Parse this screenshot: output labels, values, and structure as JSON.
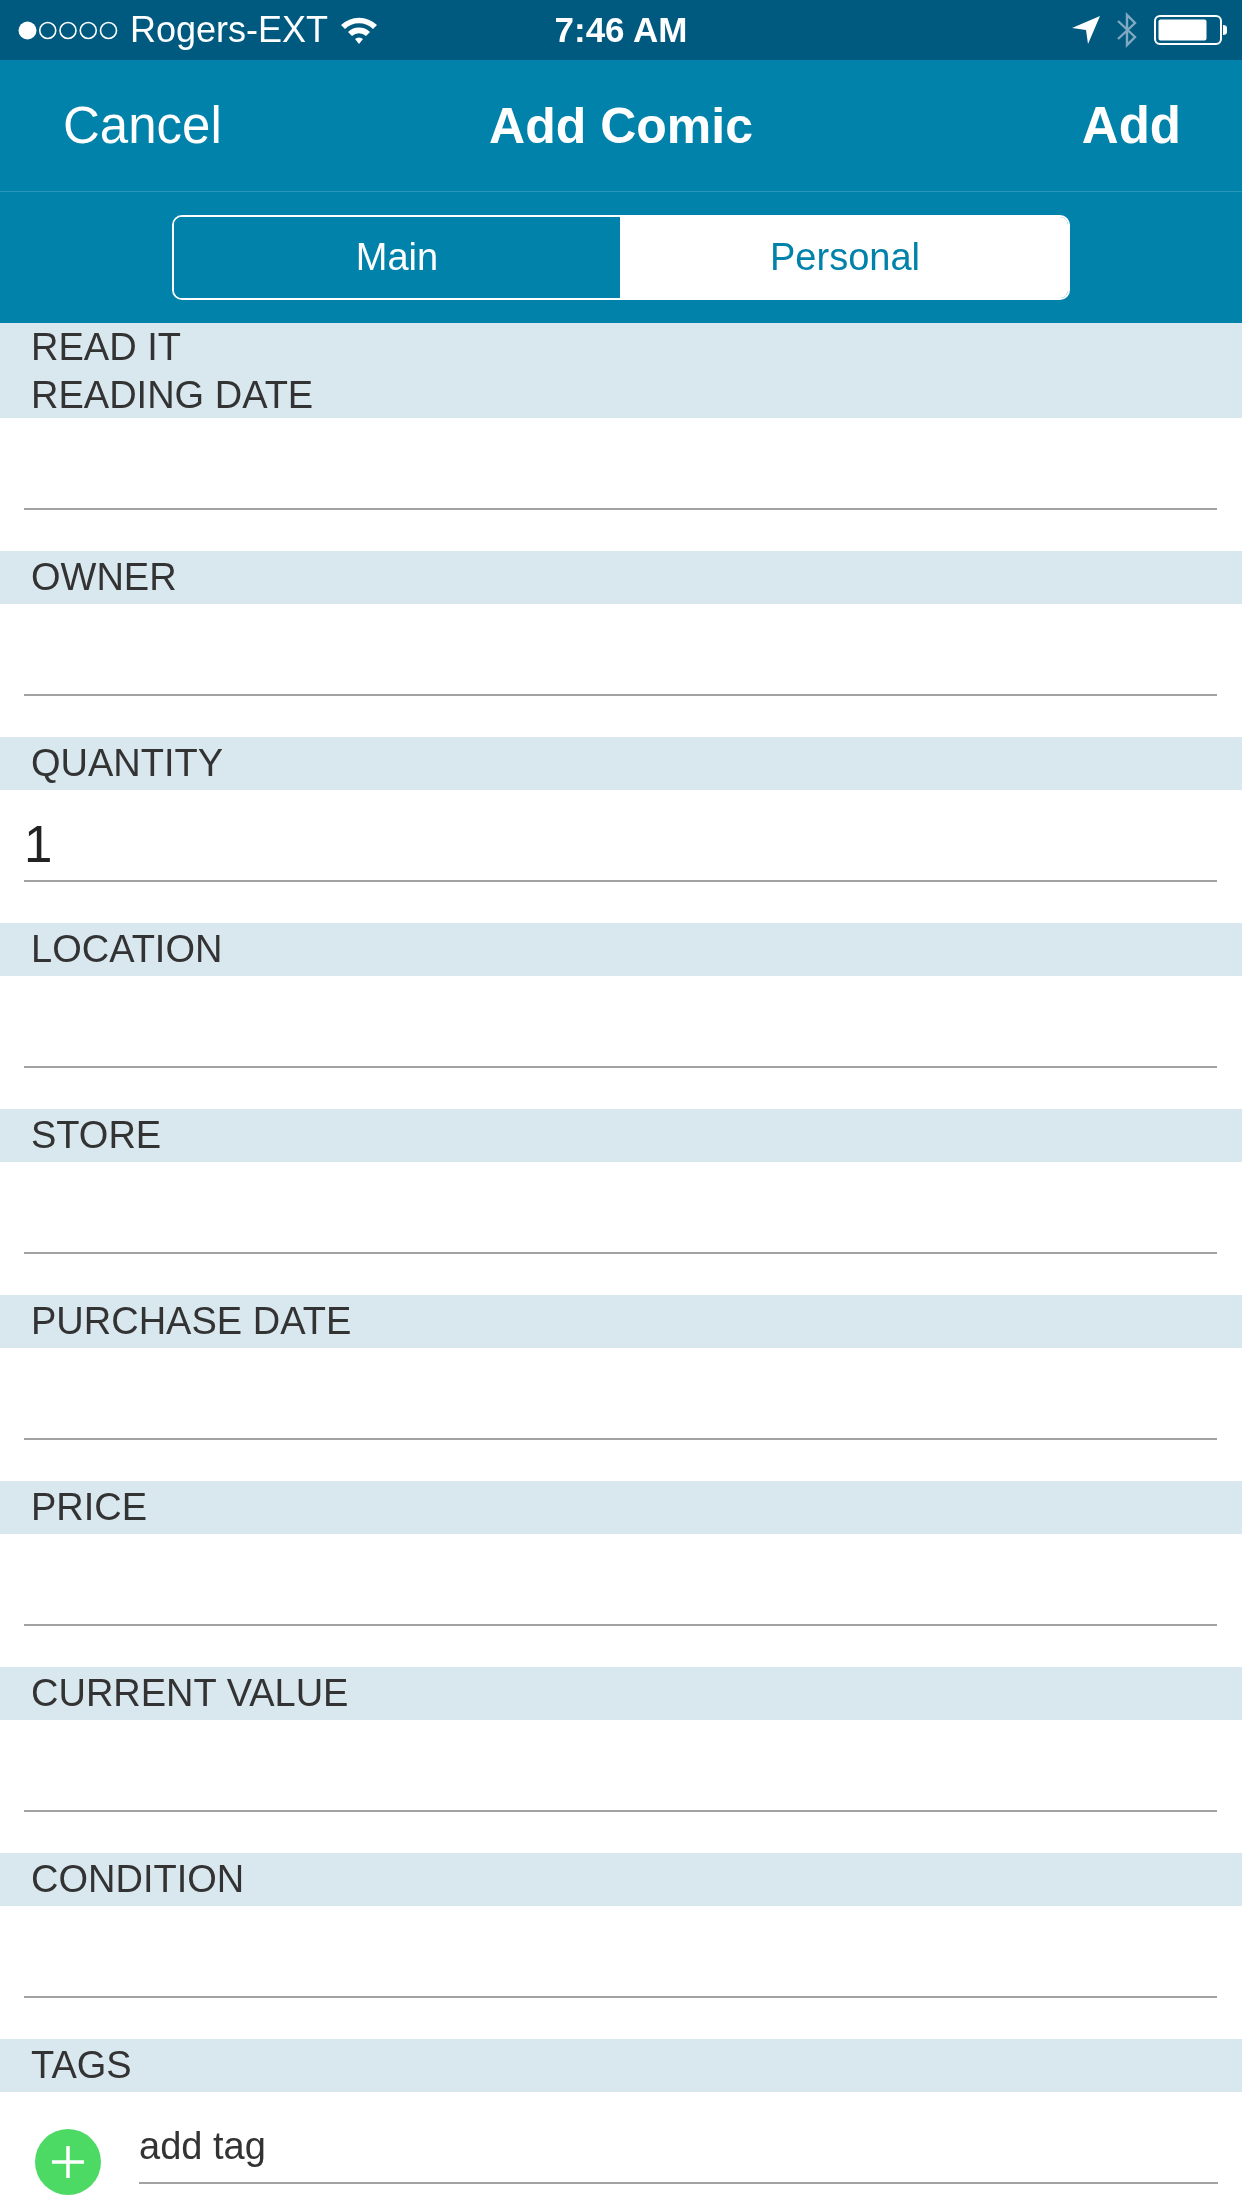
{
  "status_bar": {
    "carrier": "Rogers-EXT",
    "time": "7:46 AM"
  },
  "nav": {
    "cancel": "Cancel",
    "title": "Add Comic",
    "add": "Add"
  },
  "segments": [
    {
      "label": "Main",
      "selected": false
    },
    {
      "label": "Personal",
      "selected": true
    }
  ],
  "sections": [
    {
      "label_above": "READ IT",
      "label": "READING DATE"
    },
    {
      "label": "OWNER"
    },
    {
      "label": "QUANTITY",
      "value": "1"
    },
    {
      "label": "LOCATION"
    },
    {
      "label": "STORE"
    },
    {
      "label": "PURCHASE DATE"
    },
    {
      "label": "PRICE"
    },
    {
      "label": "CURRENT VALUE"
    },
    {
      "label": "CONDITION"
    }
  ],
  "tags": {
    "label": "TAGS",
    "add_text": "add tag"
  }
}
